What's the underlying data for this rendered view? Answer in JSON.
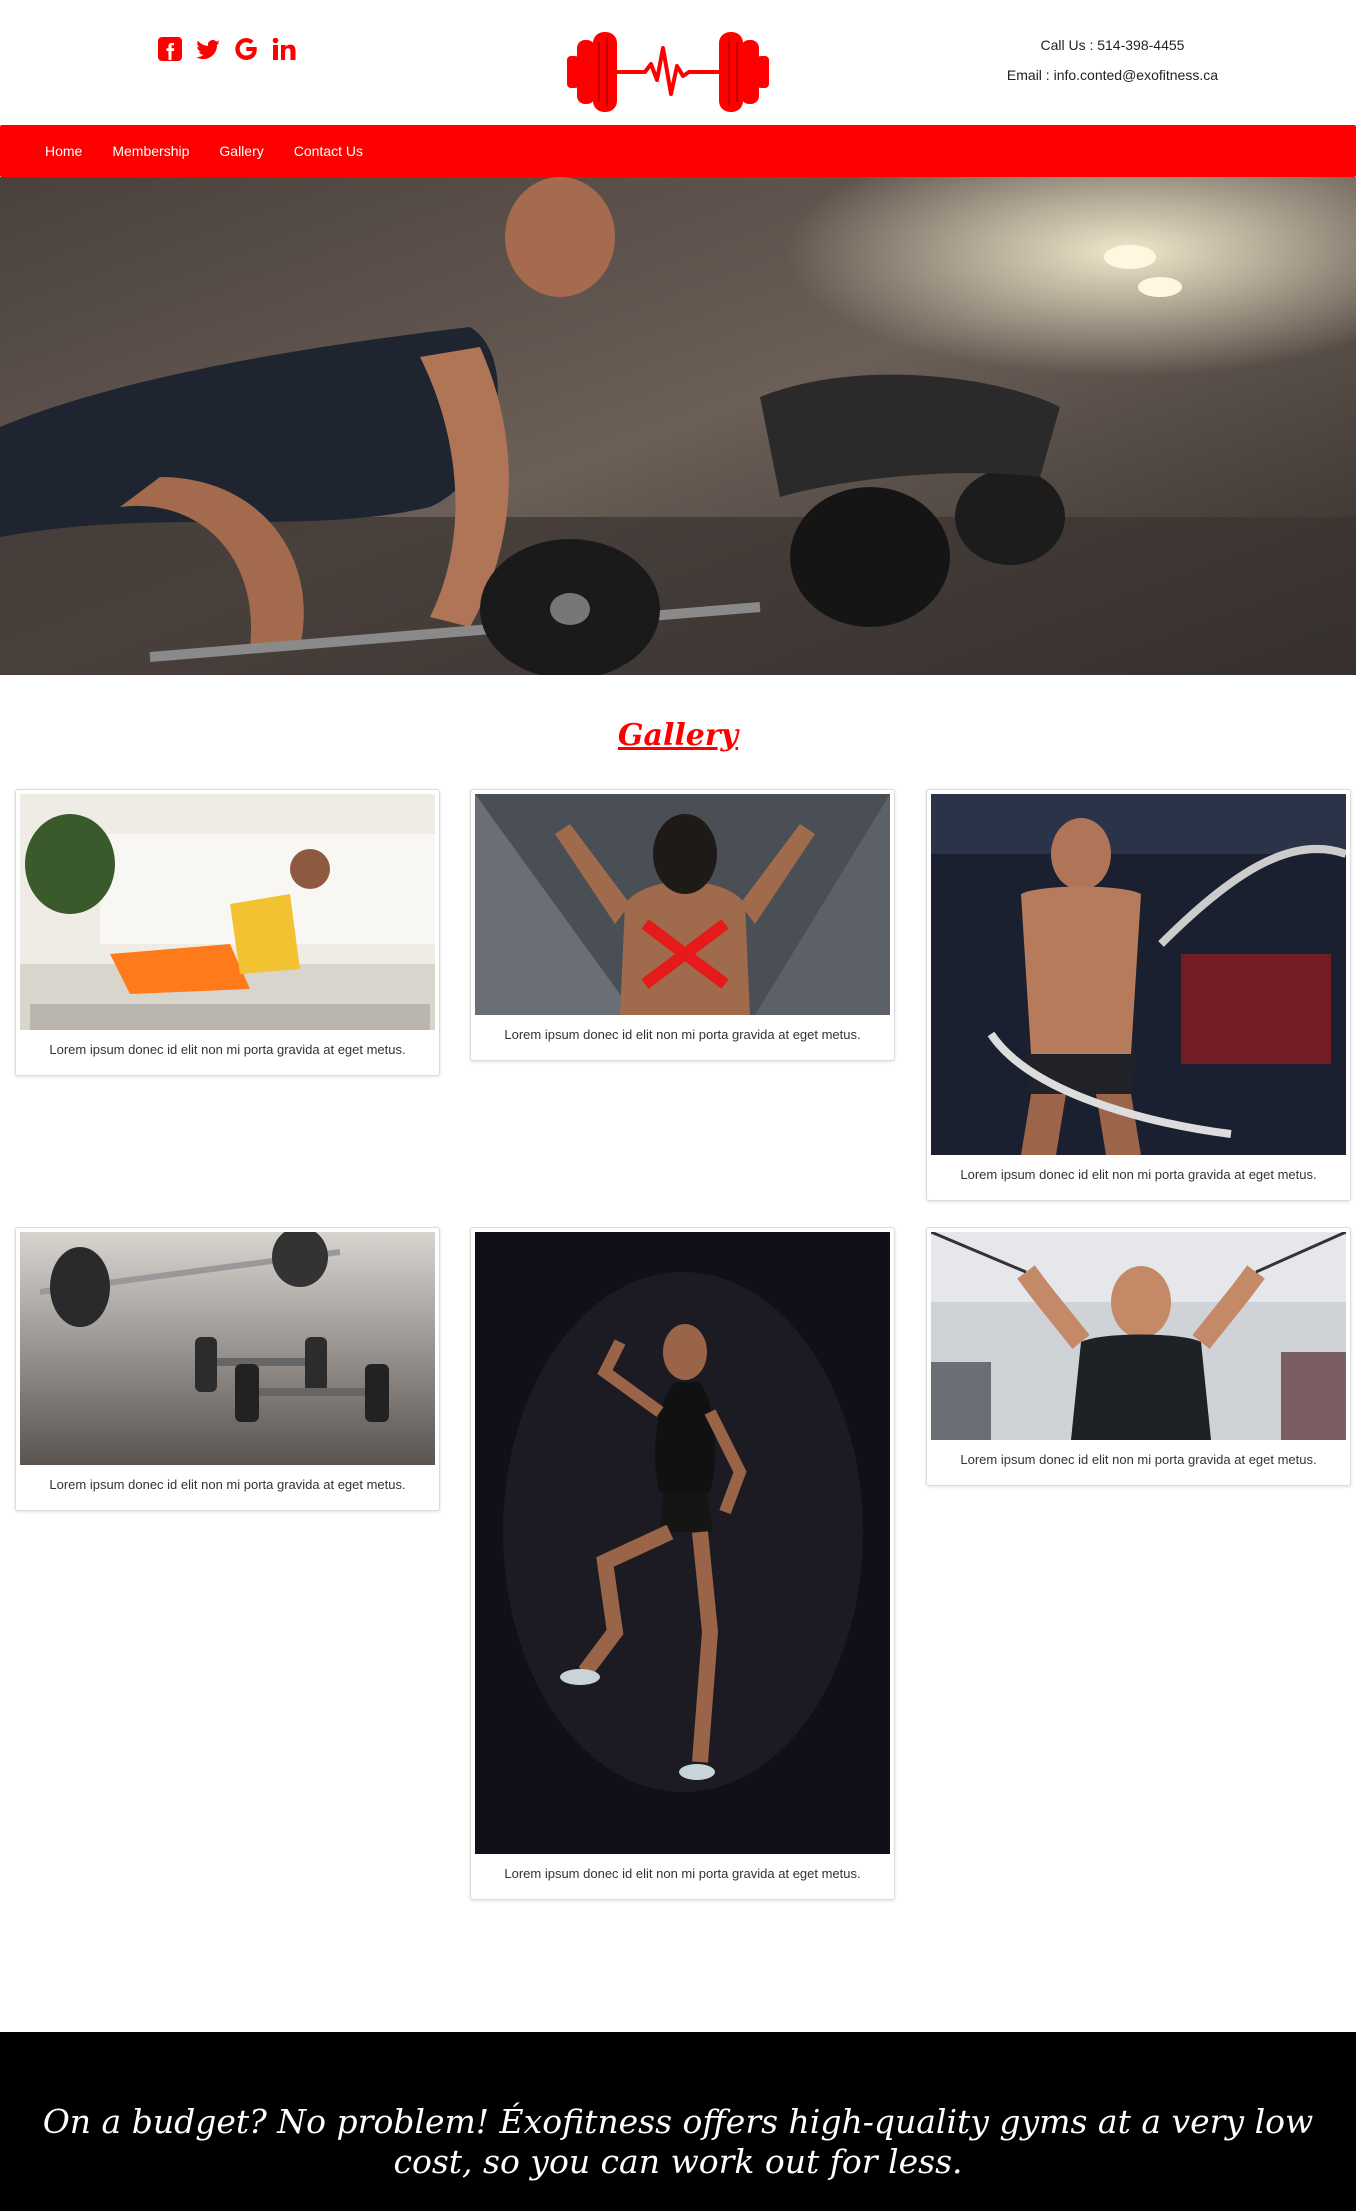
{
  "header": {
    "socials": [
      {
        "name": "facebook",
        "icon": "facebook-square-icon"
      },
      {
        "name": "twitter",
        "icon": "twitter-icon"
      },
      {
        "name": "google",
        "icon": "google-icon"
      },
      {
        "name": "linkedin",
        "icon": "linkedin-icon"
      }
    ],
    "logo_icon": "dumbbell-heartbeat-icon",
    "call": "Call Us : 514-398-4455",
    "email": "Email : info.conted@exofitness.ca"
  },
  "nav": {
    "items": [
      "Home",
      "Membership",
      "Gallery",
      "Contact Us"
    ]
  },
  "hero": {
    "image": "women-deadlift-gym-photo"
  },
  "gallery": {
    "title": "Gallery",
    "cards": [
      {
        "image": "woman-home-workout-photo",
        "caption": "Lorem ipsum donec id elit non mi porta gravida at eget metus."
      },
      {
        "image": "woman-back-flex-photo",
        "caption": "Lorem ipsum donec id elit non mi porta gravida at eget metus."
      },
      {
        "image": "man-battle-ropes-photo",
        "caption": "Lorem ipsum donec id elit non mi porta gravida at eget metus."
      },
      {
        "image": "barbell-dumbbells-floor-photo",
        "caption": "Lorem ipsum donec id elit non mi porta gravida at eget metus."
      },
      {
        "image": "woman-jumping-photo",
        "caption": "Lorem ipsum donec id elit non mi porta gravida at eget metus."
      },
      {
        "image": "man-cable-crossover-photo",
        "caption": "Lorem ipsum donec id elit non mi porta gravida at eget metus."
      }
    ]
  },
  "footer": {
    "text": "On a budget?  No problem! Éxofitness offers high-quality gyms at a very low cost, so you can work out for less."
  },
  "colors": {
    "brand_red": "#ff0000",
    "footer_bg": "#000000"
  }
}
